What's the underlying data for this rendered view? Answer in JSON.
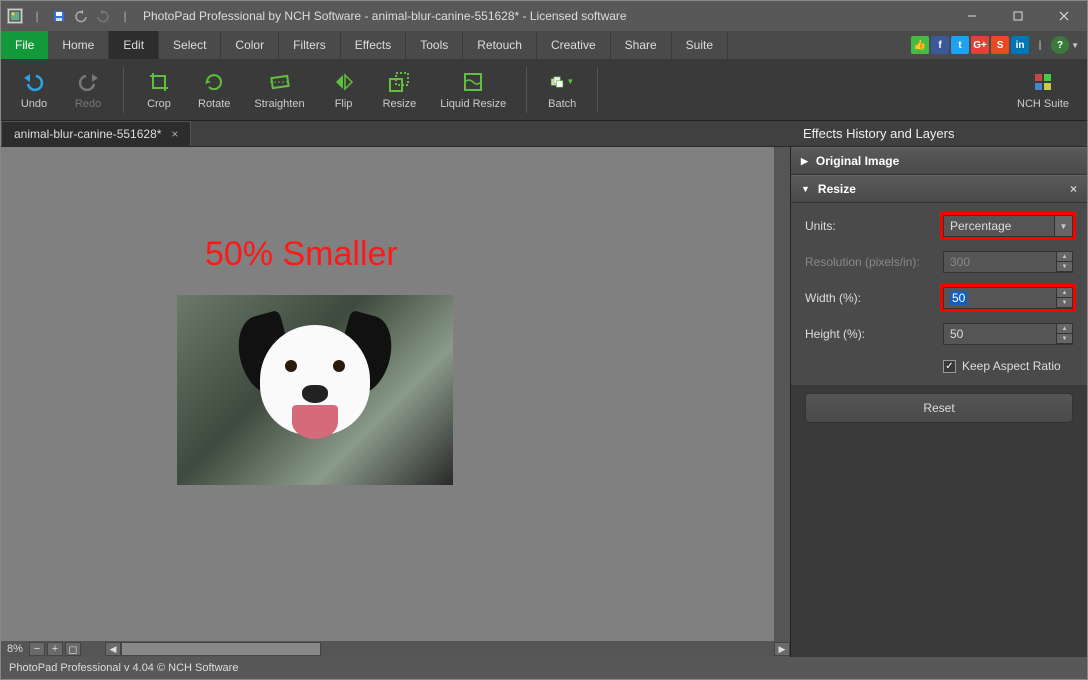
{
  "title": "PhotoPad Professional by NCH Software - animal-blur-canine-551628* - Licensed software",
  "menu": {
    "file": "File",
    "items": [
      "Home",
      "Edit",
      "Select",
      "Color",
      "Filters",
      "Effects",
      "Tools",
      "Retouch",
      "Creative",
      "Share",
      "Suite"
    ],
    "active": "Edit"
  },
  "toolbar": {
    "undo": "Undo",
    "redo": "Redo",
    "crop": "Crop",
    "rotate": "Rotate",
    "straighten": "Straighten",
    "flip": "Flip",
    "resize": "Resize",
    "liquid_resize": "Liquid Resize",
    "batch": "Batch",
    "nch_suite": "NCH Suite"
  },
  "doc_tab": {
    "name": "animal-blur-canine-551628*",
    "close": "×"
  },
  "overlay_text": "50% Smaller",
  "zoom": "8%",
  "panel": {
    "title": "Effects History and Layers",
    "original": "Original Image",
    "resize": {
      "heading": "Resize",
      "units_label": "Units:",
      "units_value": "Percentage",
      "resolution_label": "Resolution (pixels/in):",
      "resolution_value": "300",
      "width_label": "Width (%):",
      "width_value": "50",
      "height_label": "Height (%):",
      "height_value": "50",
      "keep_ar": "Keep Aspect Ratio",
      "reset": "Reset"
    }
  },
  "status": "PhotoPad Professional v 4.04 © NCH Software"
}
